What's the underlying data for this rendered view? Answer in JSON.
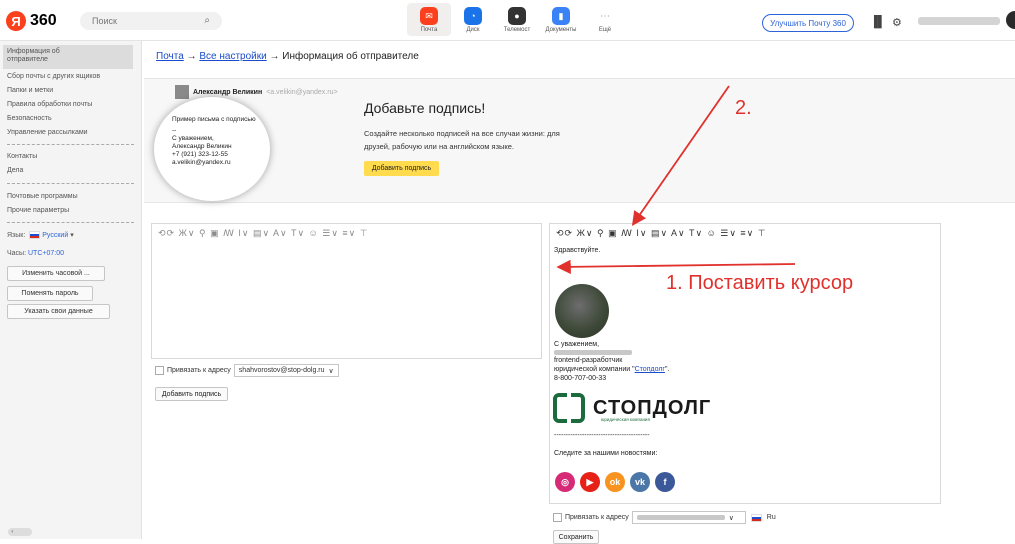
{
  "top": {
    "logo_number": "360",
    "search_placeholder": "Поиск",
    "apps": [
      {
        "label": "Почта",
        "icon": "mail-icon",
        "color": "#fc3f1d"
      },
      {
        "label": "Диск",
        "icon": "disk-icon",
        "color": "#1a73e8"
      },
      {
        "label": "Телемост",
        "icon": "telemost-icon",
        "color": "#333333"
      },
      {
        "label": "Документы",
        "icon": "documents-icon",
        "color": "#3b82f6"
      },
      {
        "label": "Ещё",
        "icon": "more-icon",
        "color": "#999999"
      }
    ],
    "upgrade_label": "Улучшить Почту 360"
  },
  "sidebar": {
    "items": [
      "Информация об отправителе",
      "Сбор почты с других ящиков",
      "Папки и метки",
      "Правила обработки почты",
      "Безопасность",
      "Управление рассылками",
      "Контакты",
      "Дела",
      "Почтовые программы",
      "Прочие параметры"
    ],
    "language_label": "Язык:",
    "language_value": "Русский",
    "timezone_label": "Часы:",
    "timezone_value": "UTC+07:00",
    "buttons": [
      "Изменить часовой ...",
      "Поменять пароль",
      "Указать свои данные"
    ]
  },
  "breadcrumb": {
    "part1": "Почта",
    "part2": "Все настройки",
    "current": "Информация об отправителе",
    "arrow": "→"
  },
  "banner": {
    "sample_name": "Александр Великин",
    "sample_email": "<a.velikin@yandex.ru>",
    "sample_lines": [
      "Пример письма с подписью",
      "--",
      "С уважением,",
      "Александр Великин",
      "+7 (921) 323-12-55",
      "a.velikin@yandex.ru"
    ],
    "heading": "Добавьте подпись!",
    "text": "Создайте несколько подписей на все случаи жизни: для друзей, рабочую или на английском языке.",
    "button": "Добавить подпись"
  },
  "left_editor": {
    "bind_label": "Привязать к адресу",
    "address": "shahvorostov@stop-dolg.ru",
    "add_button": "Добавить подпись"
  },
  "right_editor": {
    "greeting": "Здравствуйте.",
    "regards": "С уважением,",
    "role": "frontend-разработчик",
    "company_prefix": "юридической компании \"",
    "company_link": "Стопдолг",
    "company_suffix": "\".",
    "phone": "8-800-707-00-33",
    "logo_text": "СТОПДОЛГ",
    "logo_sub": "юридическая компания",
    "divider": "-----------------------------------------",
    "news": "Следите за нашими новостями:",
    "socials": [
      {
        "icon": "instagram-icon",
        "glyph": "◎",
        "color": "#d62976"
      },
      {
        "icon": "youtube-icon",
        "glyph": "▶",
        "color": "#e62117"
      },
      {
        "icon": "odnoklassniki-icon",
        "glyph": "ok",
        "color": "#f7931e"
      },
      {
        "icon": "vk-icon",
        "glyph": "vk",
        "color": "#4a76a8"
      },
      {
        "icon": "facebook-icon",
        "glyph": "f",
        "color": "#3b5998"
      }
    ],
    "bind_label": "Привязать к адресу",
    "lang": "Ru",
    "save_button": "Сохранить"
  },
  "annotations": {
    "step1": "1. Поставить курсор",
    "step2": "2."
  }
}
